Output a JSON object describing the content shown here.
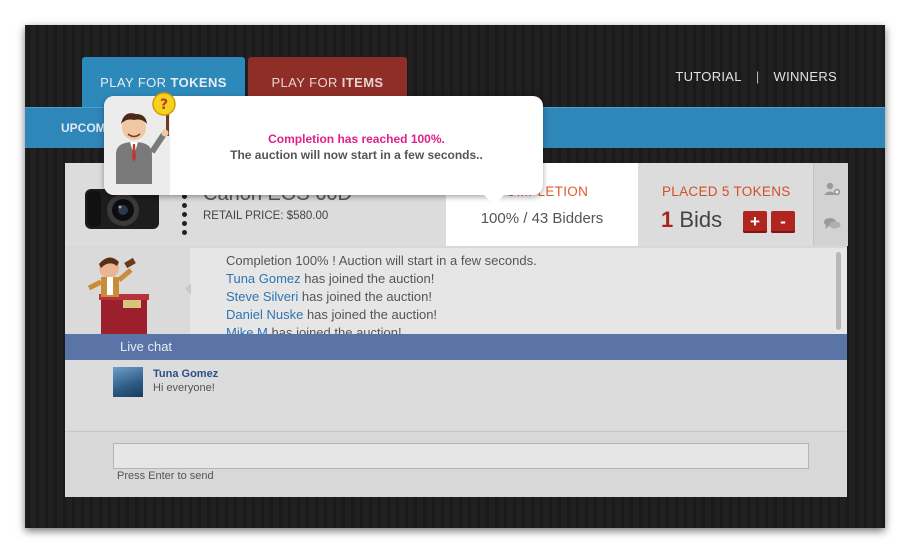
{
  "tabs": {
    "tokens": {
      "prefix": "PLAY FOR",
      "bold": "TOKENS"
    },
    "items": {
      "prefix": "PLAY FOR",
      "bold": "ITEMS"
    }
  },
  "toplinks": {
    "tutorial": "TUTORIAL",
    "separator": "|",
    "winners": "WINNERS"
  },
  "bluebar": {
    "upcoming_partial": "UPCOM"
  },
  "product": {
    "title_partial": "Canon EOS 60D",
    "retail_price": "RETAIL PRICE: $580.00",
    "completion_label": "COMPLETION",
    "completion_value": "100% / 43 Bidders",
    "placed_tokens": "PLACED 5 TOKENS",
    "bids_count": "1",
    "bids_label": "Bids",
    "plus_label": "+",
    "minus_label": "-",
    "icons": [
      "add-user-icon",
      "chat-bubbles-icon"
    ]
  },
  "feed": {
    "first_line": "Completion 100% ! Auction will start in a few seconds.",
    "joins": [
      {
        "name": "Tuna Gomez",
        "text": " has joined the auction!"
      },
      {
        "name": "Steve Silveri",
        "text": " has joined the auction!"
      },
      {
        "name": "Daniel Nuske",
        "text": " has joined the auction!"
      },
      {
        "name": "Mike M",
        "text": " has joined the auction!"
      }
    ]
  },
  "chat": {
    "header": "Live chat",
    "messages": [
      {
        "name": "Tuna Gomez",
        "text": "Hi everyone!"
      }
    ],
    "input_value": "",
    "hint": "Press Enter to send"
  },
  "popup": {
    "line1": "Completion has reached 100%.",
    "line2": "The auction will now start in a few seconds.."
  },
  "colors": {
    "tokens_tab": "#2e89bb",
    "items_tab": "#8f2d27",
    "accent_orange": "#e05b2b",
    "bid_red": "#b0261f",
    "popup_pink": "#e0208a",
    "chat_header": "#5b74a8"
  }
}
